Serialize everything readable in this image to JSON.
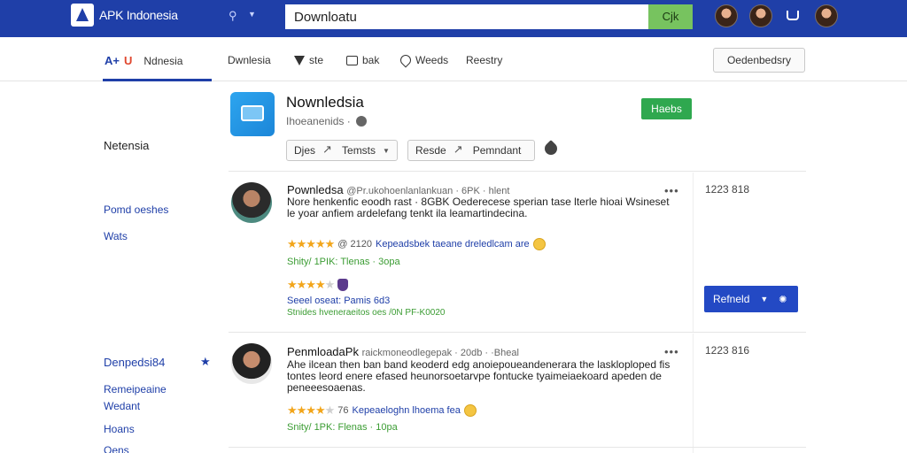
{
  "topbar": {
    "logo_text": "APK Indonesia",
    "search_value": "Downloatu",
    "search_button": "Cjk",
    "colors": {
      "bar": "#1f3fa8",
      "search_button": "#77c35f"
    }
  },
  "nav": {
    "logo_a": "A+",
    "logo_u": "U",
    "items": [
      "Ndnesia",
      "Dwnlesia",
      "ste",
      "bak",
      "Weeds",
      "Reestry"
    ],
    "download_button": "Oedenbedsry"
  },
  "sidebar": {
    "heading_top": "Netensia",
    "links_top": [
      "Pomd oeshes",
      "Wats"
    ],
    "heading_bottom": "Denpedsi84",
    "links_bottom": [
      "Remeipeaine",
      "Wedant",
      "Hoans",
      "Oens"
    ]
  },
  "app": {
    "title": "Nownledsia",
    "subtitle": "Ihoeanenids ·",
    "badge": "Haebs",
    "pills": [
      {
        "left": "Djes",
        "right": "Temsts"
      },
      {
        "left": "Resde",
        "right": "Pemndant"
      }
    ]
  },
  "reviews": [
    {
      "name": "Pownledsa",
      "meta": "@Pr.ukohoenlanlankuan · 6PK · hlent",
      "text": "Nore henkenfic eoodh rast · 8GBK Oederecese sperian tase lterle hioai Wsineset le yoar anfiem ardelefang tenkt ila leamartindecina.",
      "rating_text": "@ 2120",
      "rating_link": "Kepeadsbek taeane dreledlcam are",
      "green_line": "Shity/ 1PIK: Tlenas · 3opa",
      "small_line": "Seeel oseat: Pamis 6d3",
      "tiny_line": "Stnides hveneraeitos oes /0N PF-K0020",
      "count": "1223 818"
    },
    {
      "name": "PenmloadaPk",
      "meta": "raickmoneodlegepak · 20db · ·Bheal",
      "text": "Ahe ilcean then ban band keoderd edg anoiepoueandenerara the laskloploped fis tontes leord enere efased heunorsoetarvpe fontucke tyaimeiaekoard apeden de peneeesoaenas.",
      "rating_text": "76",
      "rating_link": "Kepeaeloghn lhoema fea",
      "green_line": "Snity/ 1PK: Flenas · 10pa",
      "count": "1223 816"
    }
  ],
  "refresh_button": "Refneld"
}
